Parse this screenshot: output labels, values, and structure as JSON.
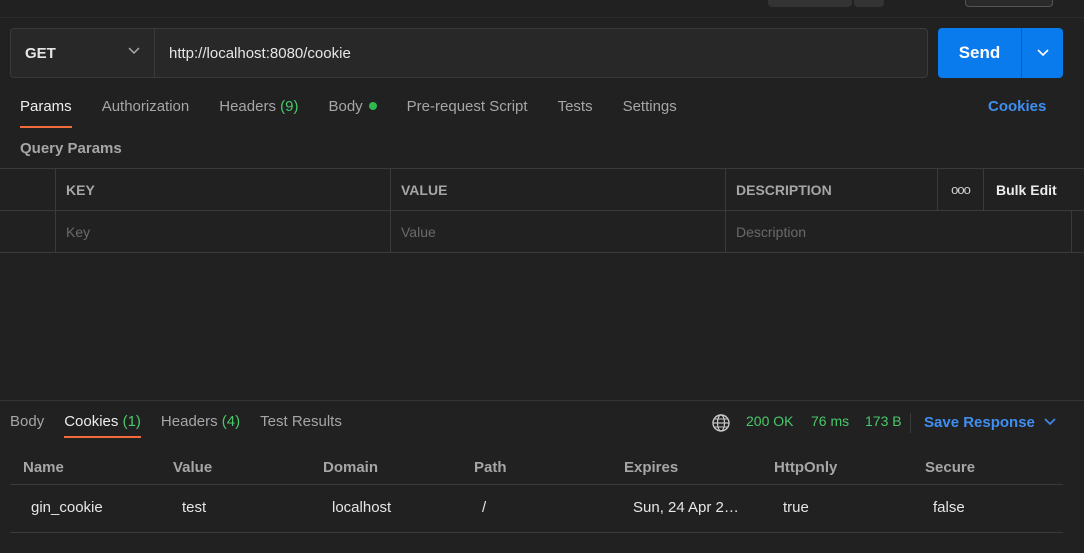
{
  "request": {
    "method": "GET",
    "url": "http://localhost:8080/cookie",
    "send_label": "Send"
  },
  "request_tabs": [
    {
      "label": "Params",
      "active": true
    },
    {
      "label": "Authorization"
    },
    {
      "label": "Headers",
      "count": "(9)"
    },
    {
      "label": "Body",
      "dot": true
    },
    {
      "label": "Pre-request Script"
    },
    {
      "label": "Tests"
    },
    {
      "label": "Settings"
    }
  ],
  "cookies_link": "Cookies",
  "query_params": {
    "title": "Query Params",
    "headers": {
      "key": "KEY",
      "value": "VALUE",
      "description": "DESCRIPTION",
      "more": "ooo",
      "bulk_edit": "Bulk Edit"
    },
    "placeholders": {
      "key": "Key",
      "value": "Value",
      "description": "Description"
    }
  },
  "response": {
    "tabs": [
      {
        "label": "Body"
      },
      {
        "label": "Cookies",
        "count": "(1)",
        "active": true
      },
      {
        "label": "Headers",
        "count": "(4)"
      },
      {
        "label": "Test Results"
      }
    ],
    "status": "200 OK",
    "time": "76 ms",
    "size": "173 B",
    "save_label": "Save Response",
    "cookie_columns": [
      "Name",
      "Value",
      "Domain",
      "Path",
      "Expires",
      "HttpOnly",
      "Secure"
    ],
    "cookies": [
      {
        "name": "gin_cookie",
        "value": "test",
        "domain": "localhost",
        "path": "/",
        "expires": "Sun, 24 Apr 2…",
        "httponly": "true",
        "secure": "false"
      }
    ]
  },
  "colors": {
    "accent": "#097bed",
    "active_tab": "#f26b3a",
    "success": "#49c86a",
    "link": "#3f8ef0"
  }
}
